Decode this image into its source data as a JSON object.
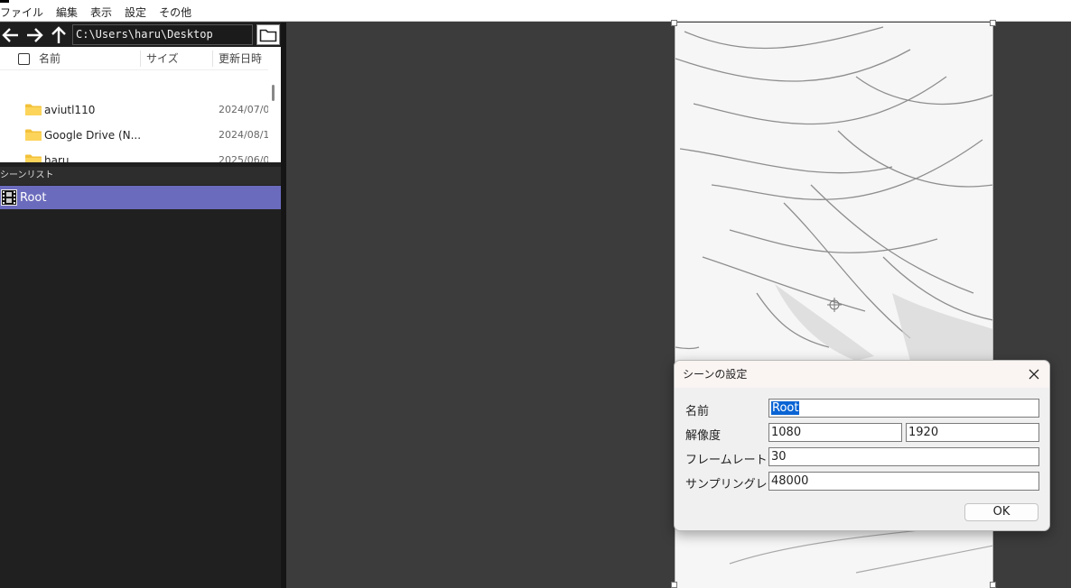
{
  "menu": [
    "ファイル",
    "編集",
    "表示",
    "設定",
    "その他"
  ],
  "browser": {
    "path": "C:\\Users\\haru\\Desktop",
    "columns": {
      "name": "名前",
      "size": "サイズ",
      "modified": "更新日時"
    },
    "files": [
      {
        "name": "aviutl110",
        "date": "2024/07/0"
      },
      {
        "name": "Google Drive (N...",
        "date": "2024/08/1"
      },
      {
        "name": "haru",
        "date": "2025/06/0"
      }
    ]
  },
  "scenes": {
    "header": "シーンリスト",
    "items": [
      {
        "name": "Root"
      }
    ]
  },
  "dialog": {
    "title": "シーンの設定",
    "name_label": "名前",
    "name_value": "Root",
    "resolution_label": "解像度",
    "width": "1080",
    "height": "1920",
    "framerate_label": "フレームレート",
    "framerate": "30",
    "samplerate_label": "サンプリングレート",
    "samplerate": "48000",
    "ok_label": "OK"
  },
  "colors": {
    "scene_selected": "#6b6bbd",
    "workspace": "#3c3c3c",
    "panel": "#202020",
    "selection": "#0a64d4"
  }
}
